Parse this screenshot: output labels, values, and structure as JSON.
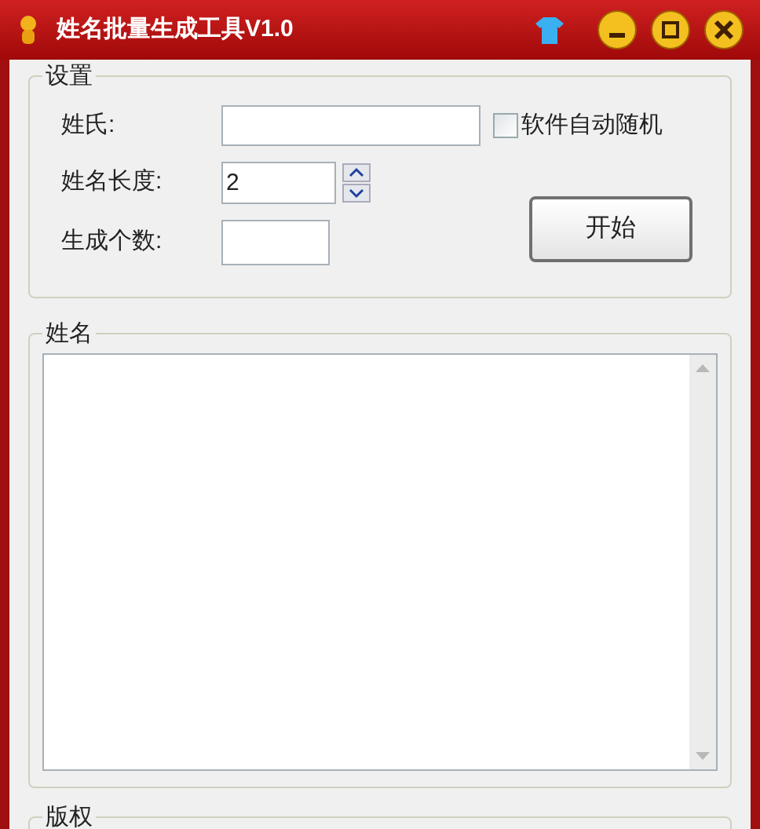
{
  "window": {
    "title": "姓名批量生成工具V1.0"
  },
  "settings": {
    "legend": "设置",
    "surname": {
      "label": "姓氏:"
    },
    "auto_random": {
      "label": "软件自动随机",
      "checked": false
    },
    "name_length": {
      "label": "姓名长度:",
      "value": "2"
    },
    "count": {
      "label": "生成个数:"
    },
    "start_button": "开始"
  },
  "names": {
    "legend": "姓名"
  },
  "copyright": {
    "legend": "版权"
  }
}
